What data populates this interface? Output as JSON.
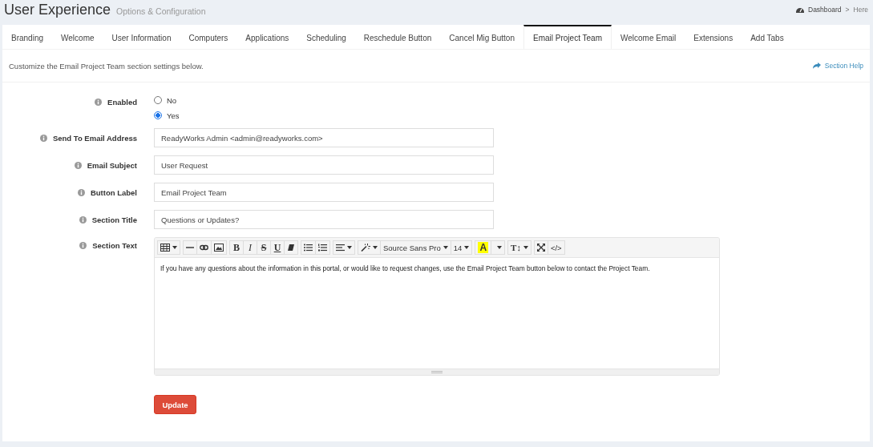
{
  "header": {
    "title": "User Experience",
    "subtitle": "Options & Configuration",
    "breadcrumb": [
      "Dashboard",
      "Here"
    ],
    "separator": ">"
  },
  "tabs": [
    {
      "label": "Branding",
      "selected": false
    },
    {
      "label": "Welcome",
      "selected": false
    },
    {
      "label": "User Information",
      "selected": false
    },
    {
      "label": "Computers",
      "selected": false
    },
    {
      "label": "Applications",
      "selected": false
    },
    {
      "label": "Scheduling",
      "selected": false
    },
    {
      "label": "Reschedule Button",
      "selected": false
    },
    {
      "label": "Cancel Mig Button",
      "selected": false
    },
    {
      "label": "Email Project Team",
      "selected": true
    },
    {
      "label": "Welcome Email",
      "selected": false
    },
    {
      "label": "Extensions",
      "selected": false
    },
    {
      "label": "Add Tabs",
      "selected": false
    }
  ],
  "description": "Customize the Email Project Team section settings below.",
  "help_link": "Section Help",
  "fields": [
    {
      "kind": "radio",
      "label": "Enabled",
      "options": [
        {
          "label": "No",
          "selected": false
        },
        {
          "label": "Yes",
          "selected": true
        }
      ]
    },
    {
      "kind": "text",
      "label": "Send To Email Address",
      "value": "ReadyWorks Admin <admin@readyworks.com>"
    },
    {
      "kind": "text",
      "label": "Email Subject",
      "value": "User Request"
    },
    {
      "kind": "text",
      "label": "Button Label",
      "value": "Email Project Team"
    },
    {
      "kind": "text",
      "label": "Section Title",
      "value": "Questions or Updates?"
    },
    {
      "kind": "editor",
      "label": "Section Text",
      "toolbar": [
        [
          {
            "kind": "table",
            "caret": true
          }
        ],
        [
          {
            "kind": "rule"
          },
          {
            "kind": "link"
          },
          {
            "kind": "image"
          }
        ],
        [
          {
            "kind": "bold",
            "label": "B"
          },
          {
            "kind": "italic",
            "label": "I"
          },
          {
            "kind": "strike",
            "label": "S"
          },
          {
            "kind": "underline",
            "label": "U"
          },
          {
            "kind": "eraser"
          }
        ],
        [
          {
            "kind": "bullets"
          },
          {
            "kind": "numbers"
          }
        ],
        [
          {
            "kind": "align",
            "caret": true
          }
        ],
        [
          {
            "kind": "magic",
            "caret": true
          },
          {
            "kind": "text",
            "label": "Source Sans Pro",
            "caret": true
          },
          {
            "kind": "text",
            "label": "14",
            "caret": true
          }
        ],
        [
          {
            "kind": "color",
            "label": "A"
          },
          {
            "kind": "caret"
          }
        ],
        [
          {
            "kind": "plain",
            "label": "T↕",
            "caret": true
          }
        ],
        [
          {
            "kind": "expand"
          },
          {
            "kind": "code",
            "label": "</>"
          }
        ]
      ],
      "value": "If you have any questions about the information in this portal, or would like to request changes, use the Email Project Team button below to contact the Project Team."
    }
  ],
  "submit": "Update"
}
